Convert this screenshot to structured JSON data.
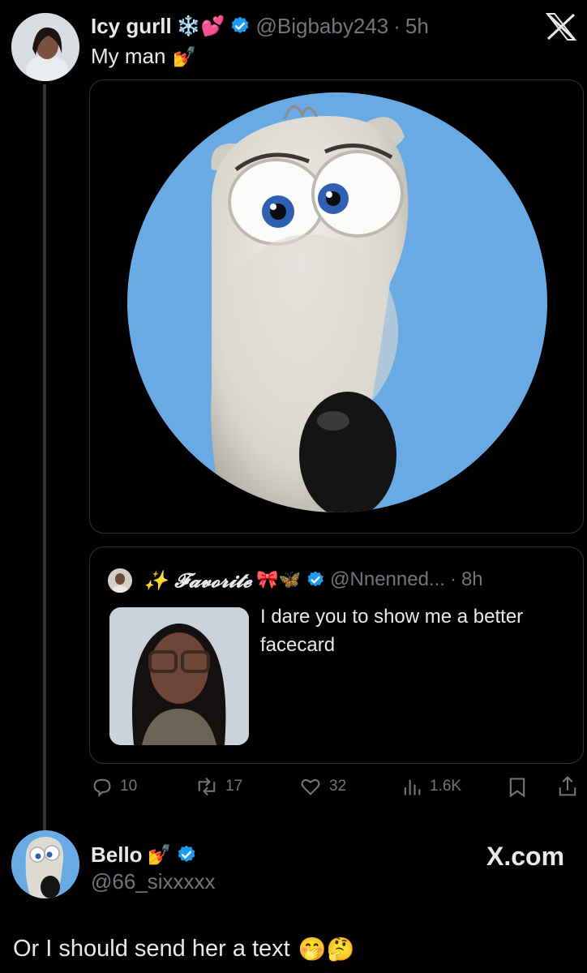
{
  "main_tweet": {
    "display_name": "Icy gurll",
    "name_emojis": "❄️💕",
    "handle": "@Bigbaby243",
    "separator": "·",
    "time": "5h",
    "text": "My man",
    "text_emoji": "💅",
    "media_alt": "Cartoon polar bear face on blue circle"
  },
  "quoted_tweet": {
    "display_name": "✨ 𝓕𝓪𝓿𝓸𝓻𝓲𝓽𝓮",
    "name_emojis": "🎀🦋",
    "handle": "@Nnenned...",
    "separator": "·",
    "time": "8h",
    "text": "I dare you to show me a better facecard"
  },
  "actions": {
    "replies": "10",
    "retweets": "17",
    "likes": "32",
    "views": "1.6K"
  },
  "reply": {
    "display_name": "Bello",
    "name_emoji": "💅",
    "handle": "@66_sixxxxx",
    "source": "X.com",
    "text": "Or I should send her a text",
    "text_emojis": "🤭🤔"
  },
  "colors": {
    "background": "#000000",
    "verified": "#1d9bf0",
    "muted": "#71767b",
    "circle_blue": "#6aaae4"
  },
  "icons": [
    "x-logo-icon",
    "verified-badge-icon",
    "reply-icon",
    "retweet-icon",
    "like-icon",
    "views-icon",
    "bookmark-icon",
    "share-icon"
  ]
}
